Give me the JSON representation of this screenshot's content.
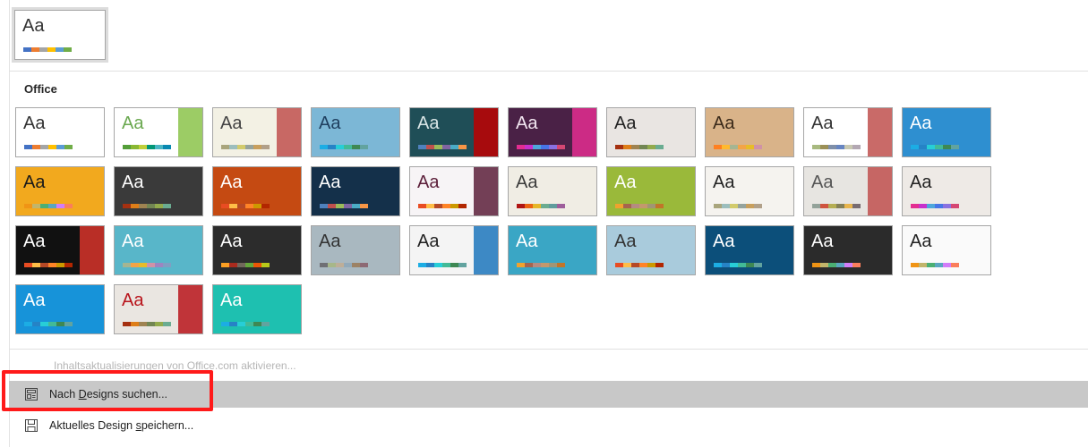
{
  "current": {
    "aa": "Aa",
    "bg": "#ffffff",
    "fg": "#333333",
    "swatches": [
      "#4472c4",
      "#ed7d31",
      "#a5a5a5",
      "#ffc000",
      "#5b9bd5",
      "#70ad47"
    ]
  },
  "section_title": "Office",
  "themes": [
    {
      "aa": "Aa",
      "bg": "#ffffff",
      "fg": "#333333",
      "sw": [
        "#4472c4",
        "#ed7d31",
        "#a5a5a5",
        "#ffc000",
        "#5b9bd5",
        "#70ad47"
      ]
    },
    {
      "aa": "Aa",
      "bg": "#ffffff",
      "fg": "#6aa84f",
      "accent": "#8bc34a",
      "sw": [
        "#549e39",
        "#8ab833",
        "#c0cf3a",
        "#029676",
        "#4ab5c4",
        "#0989b1"
      ]
    },
    {
      "aa": "Aa",
      "bg": "#f3f1e4",
      "fg": "#444444",
      "accent": "#c0504d",
      "sw": [
        "#a9a57c",
        "#9cbebd",
        "#d2cb6c",
        "#95a39d",
        "#c89f5d",
        "#b1a089"
      ]
    },
    {
      "aa": "Aa",
      "bg": "#7cb7d6",
      "fg": "#1f3f5f",
      "sw": [
        "#1cade4",
        "#2683c6",
        "#27ced7",
        "#42ba97",
        "#3e8853",
        "#62a39f"
      ]
    },
    {
      "aa": "Aa",
      "bg": "#1f4e57",
      "fg": "#d9e5e6",
      "accent": "#c00000",
      "sw": [
        "#4f81bd",
        "#c0504d",
        "#9bbb59",
        "#8064a2",
        "#4bacc6",
        "#f79646"
      ]
    },
    {
      "aa": "Aa",
      "bg": "#4a2146",
      "fg": "#f2e6f1",
      "accent": "#e32d91",
      "sw": [
        "#e32d91",
        "#c830cc",
        "#4ea6dc",
        "#4775e7",
        "#8971e1",
        "#d54773"
      ]
    },
    {
      "aa": "Aa",
      "bg": "#e9e5e2",
      "fg": "#222222",
      "sw": [
        "#a53010",
        "#de7e18",
        "#9f8351",
        "#728653",
        "#92aa4c",
        "#6aac91"
      ]
    },
    {
      "aa": "Aa",
      "bg": "#d9b389",
      "fg": "#3b2a1a",
      "sw": [
        "#ff8021",
        "#ffb92e",
        "#a5b592",
        "#f3a447",
        "#e7bc29",
        "#d092a7"
      ]
    },
    {
      "aa": "Aa",
      "bg": "#ffffff",
      "fg": "#333333",
      "accent": "#c0504d",
      "sw": [
        "#a8b97f",
        "#9b9057",
        "#7f8fa9",
        "#6785c1",
        "#c8c8b1",
        "#b3a8b3"
      ]
    },
    {
      "aa": "Aa",
      "bg": "#2e8fd0",
      "fg": "#ffffff",
      "sw": [
        "#1cade4",
        "#2683c6",
        "#27ced7",
        "#42ba97",
        "#3e8853",
        "#62a39f"
      ]
    },
    {
      "aa": "Aa",
      "bg": "#f2a91e",
      "fg": "#1a1a1a",
      "sw": [
        "#f09415",
        "#c1b56b",
        "#4baf73",
        "#5aa6c0",
        "#d17df9",
        "#fa7e5c"
      ]
    },
    {
      "aa": "Aa",
      "bg": "#3a3a3a",
      "fg": "#ffffff",
      "sw": [
        "#a53010",
        "#de7e18",
        "#9f8351",
        "#728653",
        "#92aa4c",
        "#6aac91"
      ]
    },
    {
      "aa": "Aa",
      "bg": "#c54a12",
      "fg": "#ffffff",
      "sw": [
        "#e84c22",
        "#ffbd47",
        "#b64926",
        "#ff8427",
        "#cc9900",
        "#b22600"
      ]
    },
    {
      "aa": "Aa",
      "bg": "#14304a",
      "fg": "#ffffff",
      "sw": [
        "#4f81bd",
        "#c0504d",
        "#9bbb59",
        "#8064a2",
        "#4bacc6",
        "#f79646"
      ]
    },
    {
      "aa": "Aa",
      "bg": "#f7f4f6",
      "fg": "#5c1f3a",
      "accent": "#5c1f3a",
      "sw": [
        "#e84c22",
        "#ffbd47",
        "#b64926",
        "#ff8427",
        "#cc9900",
        "#b22600"
      ]
    },
    {
      "aa": "Aa",
      "bg": "#f0ede4",
      "fg": "#3a3a3a",
      "sw": [
        "#b01513",
        "#ea6312",
        "#e6b729",
        "#6aac90",
        "#5f9c9d",
        "#9e5e9b"
      ]
    },
    {
      "aa": "Aa",
      "bg": "#9ab93a",
      "fg": "#ffffff",
      "sw": [
        "#f0a22e",
        "#a5644e",
        "#b58b80",
        "#c3986d",
        "#a19574",
        "#c17529"
      ]
    },
    {
      "aa": "Aa",
      "bg": "#f5f3ef",
      "fg": "#222222",
      "sw": [
        "#a9a57c",
        "#9cbebd",
        "#d2cb6c",
        "#95a39d",
        "#c89f5d",
        "#b1a089"
      ]
    },
    {
      "aa": "Aa",
      "bg": "#e7e5e1",
      "fg": "#555555",
      "accent": "#c0504d",
      "sw": [
        "#93a299",
        "#cf543f",
        "#b5ae53",
        "#848058",
        "#e8b54d",
        "#786c71"
      ]
    },
    {
      "aa": "Aa",
      "bg": "#eeeae6",
      "fg": "#222222",
      "sw": [
        "#e32d91",
        "#c830cc",
        "#4ea6dc",
        "#4775e7",
        "#8971e1",
        "#d54773"
      ]
    },
    {
      "aa": "Aa",
      "bg": "#111111",
      "fg": "#ffffff",
      "accent": "#d7342a",
      "sw": [
        "#e84c22",
        "#ffbd47",
        "#b64926",
        "#ff8427",
        "#cc9900",
        "#b22600"
      ]
    },
    {
      "aa": "Aa",
      "bg": "#58b6c9",
      "fg": "#ffffff",
      "sw": [
        "#a5b592",
        "#f3a447",
        "#e7bc29",
        "#d092a7",
        "#9c85c0",
        "#809ec2"
      ]
    },
    {
      "aa": "Aa",
      "bg": "#2c2c2c",
      "fg": "#ffffff",
      "sw": [
        "#fda023",
        "#aa2b1e",
        "#71685c",
        "#64a73b",
        "#eb5605",
        "#b9ca1a"
      ]
    },
    {
      "aa": "Aa",
      "bg": "#a9b8c0",
      "fg": "#333333",
      "sw": [
        "#6f6f74",
        "#a7b789",
        "#beae98",
        "#92a9b9",
        "#9c8265",
        "#8d6974"
      ]
    },
    {
      "aa": "Aa",
      "bg": "#f4f4f4",
      "fg": "#222222",
      "accent": "#1c75bc",
      "sw": [
        "#1cade4",
        "#2683c6",
        "#27ced7",
        "#42ba97",
        "#3e8853",
        "#62a39f"
      ]
    },
    {
      "aa": "Aa",
      "bg": "#3aa6c5",
      "fg": "#ffffff",
      "sw": [
        "#f0a22e",
        "#a5644e",
        "#b58b80",
        "#c3986d",
        "#a19574",
        "#c17529"
      ]
    },
    {
      "aa": "Aa",
      "bg": "#a9cbdc",
      "fg": "#333333",
      "sw": [
        "#e84c22",
        "#ffbd47",
        "#b64926",
        "#ff8427",
        "#cc9900",
        "#b22600"
      ]
    },
    {
      "aa": "Aa",
      "bg": "#0c4f7a",
      "fg": "#ffffff",
      "sw": [
        "#1cade4",
        "#2683c6",
        "#27ced7",
        "#42ba97",
        "#3e8853",
        "#62a39f"
      ]
    },
    {
      "aa": "Aa",
      "bg": "#2b2b2b",
      "fg": "#ffffff",
      "sw": [
        "#f09415",
        "#c1b56b",
        "#4baf73",
        "#5aa6c0",
        "#d17df9",
        "#fa7e5c"
      ]
    },
    {
      "aa": "Aa",
      "bg": "#fafafa",
      "fg": "#222222",
      "sw": [
        "#f09415",
        "#c1b56b",
        "#4baf73",
        "#5aa6c0",
        "#d17df9",
        "#fa7e5c"
      ]
    },
    {
      "aa": "Aa",
      "bg": "#1793d9",
      "fg": "#ffffff",
      "sw": [
        "#1cade4",
        "#2683c6",
        "#27ced7",
        "#42ba97",
        "#3e8853",
        "#62a39f"
      ]
    },
    {
      "aa": "Aa",
      "bg": "#eae6e1",
      "fg": "#b8141b",
      "accent": "#b8141b",
      "sw": [
        "#a53010",
        "#de7e18",
        "#9f8351",
        "#728653",
        "#92aa4c",
        "#6aac91"
      ]
    },
    {
      "aa": "Aa",
      "bg": "#1ec0b0",
      "fg": "#ffffff",
      "sw": [
        "#1cade4",
        "#2683c6",
        "#27ced7",
        "#42ba97",
        "#3e8853",
        "#62a39f"
      ]
    }
  ],
  "update_link": "Inhaltsaktualisierungen von Office.com aktivieren...",
  "commands": {
    "browse": {
      "pre": "Nach ",
      "key": "D",
      "post": "esigns suchen..."
    },
    "save": {
      "pre": "Aktuelles Design ",
      "key": "s",
      "post": "peichern..."
    }
  }
}
